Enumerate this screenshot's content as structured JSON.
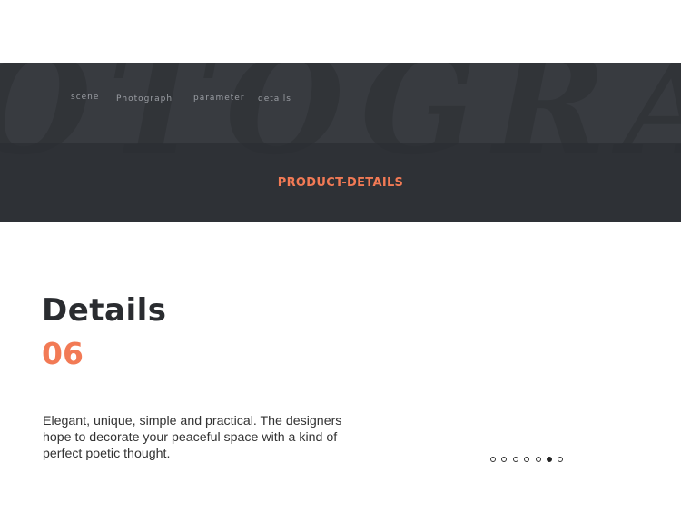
{
  "banner": {
    "background_word": "OTOGRA",
    "nav": [
      {
        "label": "scene"
      },
      {
        "label": "Photograph"
      },
      {
        "label": "parameter"
      },
      {
        "label": "details"
      }
    ],
    "section_title": "PRODUCT-DETAILS"
  },
  "content": {
    "heading": "Details",
    "number": "06",
    "description": "Elegant, unique, simple and practical. The designers hope to decorate your peaceful space with a kind of perfect poetic thought."
  },
  "pagination": {
    "total": 7,
    "active_index": 5
  },
  "colors": {
    "accent": "#f27a55",
    "banner_dark": "#2e3136",
    "banner_light": "#383b40",
    "heading": "#2a2c30"
  }
}
